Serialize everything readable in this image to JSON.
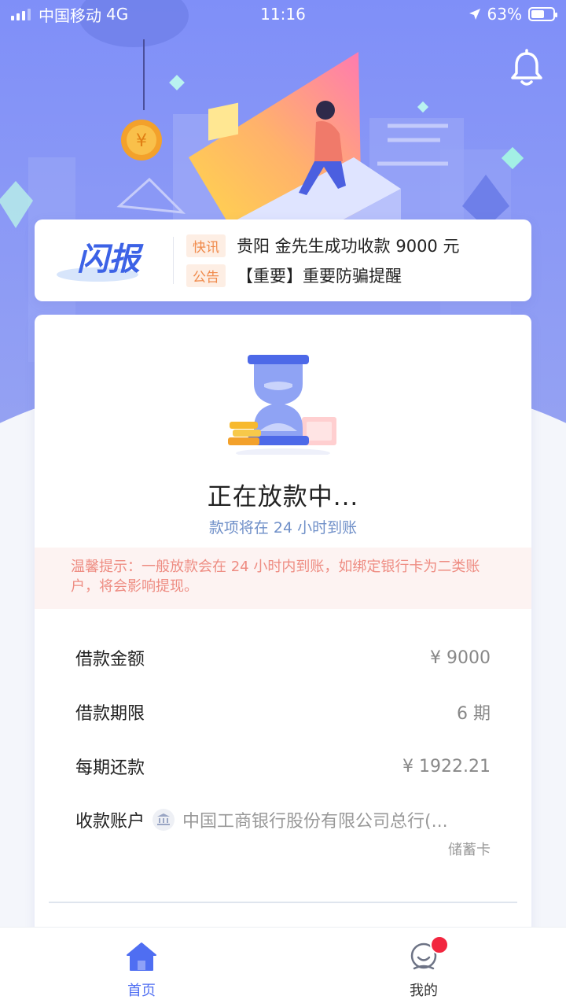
{
  "status_bar": {
    "carrier": "中国移动",
    "network": "4G",
    "time": "11:16",
    "battery": "63%",
    "battery_level": 0.63
  },
  "news": {
    "logo_text": "闪报",
    "items": [
      {
        "tag": "快讯",
        "text": "贵阳 金先生成功收款 9000 元"
      },
      {
        "tag": "公告",
        "text": "【重要】重要防骗提醒"
      }
    ]
  },
  "loan_status": {
    "title": "正在放款中...",
    "subtitle": "款项将在 24 小时到账"
  },
  "tip": {
    "label": "温馨提示：",
    "text": "一般放款会在 24 小时内到账，如绑定银行卡为二类账户，将会影响提现。"
  },
  "details": {
    "amount_label": "借款金额",
    "amount_value": "¥ 9000",
    "term_label": "借款期限",
    "term_value": "6 期",
    "installment_label": "每期还款",
    "installment_value": "¥ 1922.21",
    "account_label": "收款账户",
    "bank_name": "中国工商银行股份有限公司总行(...",
    "account_type": "储蓄卡"
  },
  "tabs": {
    "home": "首页",
    "me": "我的"
  },
  "colors": {
    "brand": "#4f6ef2",
    "hero": "#8a98f6",
    "notice_badge": "#f2263f",
    "tip_text": "#ee8c82"
  }
}
